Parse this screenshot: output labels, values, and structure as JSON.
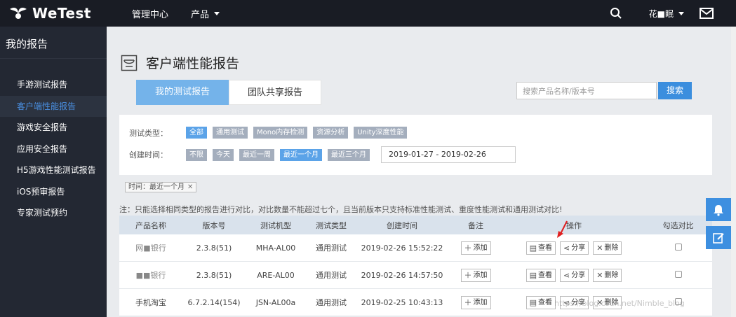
{
  "colors": {
    "topbar": "#191c24",
    "sidebar": "#232833",
    "accent": "#3b8ede",
    "tab_active": "#74b3ea"
  },
  "header": {
    "logo_text": "WeTest",
    "nav": [
      {
        "label": "管理中心"
      },
      {
        "label": "产品"
      }
    ],
    "user_name": "花■眠"
  },
  "sidebar": {
    "title": "我的报告",
    "items": [
      {
        "label": "手游测试报告"
      },
      {
        "label": "客户端性能报告"
      },
      {
        "label": "游戏安全报告"
      },
      {
        "label": "应用安全报告"
      },
      {
        "label": "H5游戏性能测试报告"
      },
      {
        "label": "iOS预审报告"
      },
      {
        "label": "专家测试预约"
      }
    ]
  },
  "main": {
    "title": "客户端性能报告",
    "tabs": [
      {
        "label": "我的测试报告"
      },
      {
        "label": "团队共享报告"
      }
    ],
    "search": {
      "placeholder": "搜索产品名称/版本号",
      "button": "搜索"
    },
    "filters": {
      "type_label": "测试类型：",
      "type_options": [
        "全部",
        "通用测试",
        "Mono内存检测",
        "资源分析",
        "Unity深度性能"
      ],
      "time_label": "创建时间：",
      "time_options": [
        "不限",
        "今天",
        "最近一周",
        "最近一个月",
        "最近三个月"
      ],
      "date_range": "2019-01-27 - 2019-02-26"
    },
    "active_tag": "时间：最近一个月",
    "note": "注：只能选择相同类型的报告进行对比，对比数量不能超过七个，且当前版本只支持标准性能测试、重度性能测试和通用测试对比!",
    "table": {
      "headers": [
        "产品名称",
        "版本号",
        "测试机型",
        "测试类型",
        "创建时间",
        "备注",
        "操作",
        "勾选对比"
      ],
      "rows": [
        {
          "name": "网■银行",
          "version": "2.3.8(51)",
          "device": "MHA-AL00",
          "type": "通用测试",
          "created": "2019-02-26 15:52:22"
        },
        {
          "name": "■■银行",
          "version": "2.3.8(51)",
          "device": "ARE-AL00",
          "type": "通用测试",
          "created": "2019-02-26 14:57:50"
        },
        {
          "name": "手机淘宝",
          "version": "6.7.2.14(154)",
          "device": "JSN-AL00a",
          "type": "通用测试",
          "created": "2019-02-25 10:43:13"
        }
      ],
      "add_label": "添加",
      "view_label": "查看",
      "share_label": "分享",
      "delete_label": "删除"
    }
  },
  "watermark": "https://blog.csdn.net/Nimble_blog"
}
